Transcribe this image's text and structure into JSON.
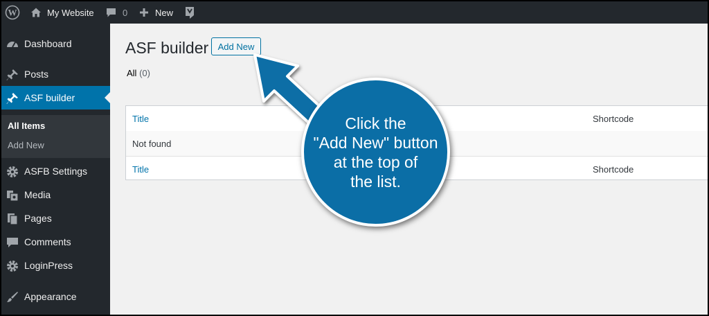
{
  "adminbar": {
    "site_name": "My Website",
    "comments_count": "0",
    "new_label": "New"
  },
  "sidebar": {
    "items": [
      {
        "label": "Dashboard",
        "icon": "dashboard-icon"
      },
      {
        "label": "Posts",
        "icon": "pin-icon"
      },
      {
        "label": "ASF builder",
        "icon": "pin-icon",
        "current": true
      },
      {
        "label": "ASFB Settings",
        "icon": "gear-icon"
      },
      {
        "label": "Media",
        "icon": "media-icon"
      },
      {
        "label": "Pages",
        "icon": "pages-icon"
      },
      {
        "label": "Comments",
        "icon": "comment-icon"
      },
      {
        "label": "LoginPress",
        "icon": "gear-icon"
      },
      {
        "label": "Appearance",
        "icon": "brush-icon"
      }
    ],
    "submenu": [
      {
        "label": "All Items",
        "current": true
      },
      {
        "label": "Add New"
      }
    ]
  },
  "main": {
    "title": "ASF builder",
    "add_new_label": "Add New",
    "filter_all": "All",
    "filter_all_count": "(0)",
    "table": {
      "columns": [
        "Title",
        "Shortcode"
      ],
      "empty_message": "Not found"
    }
  },
  "callout": {
    "lines": [
      "Click the",
      "\"Add New\" button",
      "at the top of",
      "the list."
    ]
  },
  "colors": {
    "admin_dark": "#23282d",
    "accent": "#0073aa",
    "callout_blue": "#0b6ea6"
  }
}
